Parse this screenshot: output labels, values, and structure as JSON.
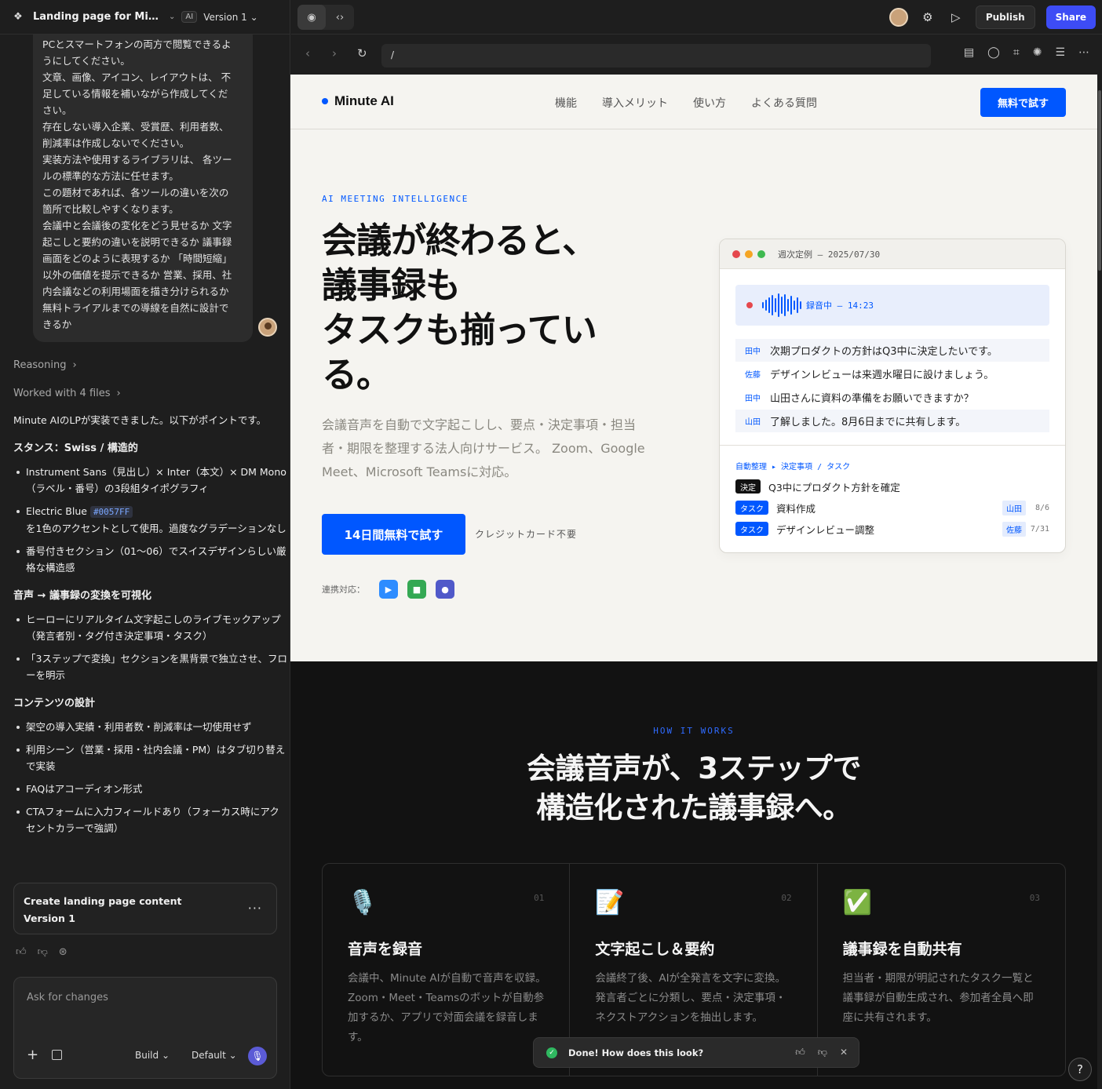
{
  "header": {
    "project_title": "Landing page for Minut...",
    "ai_badge": "AI",
    "version": "Version 1"
  },
  "chat": {
    "user_message": [
      "PCとスマートフォンの両方で閲覧できるよ",
      "うにしてください。",
      "文章、画像、アイコン、レイアウトは、 不",
      "足している情報を補いながら作成してくだ",
      "さい。",
      "存在しない導入企業、受賞歴、利用者数、",
      "削減率は作成しないでください。",
      "実装方法や使用するライブラリは、 各ツー",
      "ルの標準的な方法に任せます。",
      "この題材であれば、各ツールの違いを次の",
      "箇所で比較しやすくなります。",
      "会議中と会議後の変化をどう見せるか 文字",
      "起こしと要約の違いを説明できるか 議事録",
      "画面をどのように表現するか 「時間短縮」",
      "以外の価値を提示できるか 営業、採用、社",
      "内会議などの利用場面を描き分けられるか",
      "無料トライアルまでの導線を自然に設計で",
      "きるか"
    ],
    "reasoning_label": "Reasoning",
    "worked_label": "Worked with 4 files",
    "reply_intro": "Minute AIのLPが実装できました。以下がポイントです。",
    "sections": [
      {
        "heading": "スタンス：Swiss / 構造的",
        "items": [
          {
            "text": "Instrument Sans（見出し）× Inter（本文）× DM Mono（ラベル・番号）の3段組タイポグラフィ"
          },
          {
            "prefix": "Electric Blue ",
            "code": "#0057FF",
            "text": "を1色のアクセントとして使用。過度なグラデーションなし"
          },
          {
            "text": "番号付きセクション（01〜06）でスイスデザインらしい厳格な構造感"
          }
        ]
      },
      {
        "heading": "音声 → 議事録の変換を可視化",
        "items": [
          {
            "text": "ヒーローにリアルタイム文字起こしのライブモックアップ（発言者別・タグ付き決定事項・タスク）"
          },
          {
            "text": "「3ステップで変換」セクションを黒背景で独立させ、フローを明示"
          }
        ]
      },
      {
        "heading": "コンテンツの設計",
        "items": [
          {
            "text": "架空の導入実績・利用者数・削減率は一切使用せず"
          },
          {
            "text": "利用シーン（営業・採用・社内会議・PM）はタブ切り替えで実装"
          },
          {
            "text": "FAQはアコーディオン形式"
          },
          {
            "text": "CTAフォームに入力フィールドあり（フォーカス時にアクセントカラーで強調）"
          }
        ]
      }
    ],
    "version_card": {
      "title": "Create landing page content",
      "version": "Version 1",
      "more": "···"
    },
    "composer": {
      "placeholder": "Ask for changes",
      "plus": "+",
      "mode": "Build",
      "model": "Default"
    }
  },
  "topbar": {
    "publish": "Publish",
    "share": "Share"
  },
  "urlbar": {
    "url": "/"
  },
  "site": {
    "brand": "Minute AI",
    "menu": [
      "機能",
      "導入メリット",
      "使い方",
      "よくある質問"
    ],
    "nav_cta": "無料で試す",
    "eyebrow": "AI MEETING INTELLIGENCE",
    "hero_lines": [
      "会議が終わると、",
      "議事録も",
      "タスクも揃ってい",
      "る。"
    ],
    "hero_sub": "会議音声を自動で文字起こしし、要点・決定事項・担当者・期限を整理する法人向けサービス。 Zoom、Google Meet、Microsoft Teamsに対応。",
    "hero_cta": "14日間無料で試す",
    "hero_note": "クレジットカード不要",
    "integrations_label": "連携対応：",
    "mock": {
      "title": "週次定例 — 2025/07/30",
      "recording": "録音中 — 14:23",
      "transcript": [
        {
          "speaker": "田中",
          "text": "次期プロダクトの方針はQ3中に決定したいです。",
          "highlight": true
        },
        {
          "speaker": "佐藤",
          "text": "デザインレビューは来週水曜日に設けましょう。",
          "highlight": false
        },
        {
          "speaker": "田中",
          "text": "山田さんに資料の準備をお願いできますか？",
          "highlight": false
        },
        {
          "speaker": "山田",
          "text": "了解しました。8月6日までに共有します。",
          "highlight": true
        }
      ],
      "breadcrumb": "自動整理 ▸ 決定事項 / タスク",
      "items": [
        {
          "tag": "決定",
          "kind": "dec",
          "text": "Q3中にプロダクト方針を確定",
          "assignee": "",
          "due": ""
        },
        {
          "tag": "タスク",
          "kind": "task",
          "text": "資料作成",
          "assignee": "山田",
          "due": "8/6"
        },
        {
          "tag": "タスク",
          "kind": "task",
          "text": "デザインレビュー調整",
          "assignee": "佐藤",
          "due": "7/31"
        }
      ]
    },
    "how": {
      "eyebrow": "HOW IT WORKS",
      "heading_lines": [
        "会議音声が、3ステップで",
        "構造化された議事録へ。"
      ],
      "steps": [
        {
          "emoji": "🎙️",
          "num": "01",
          "title": "音声を録音",
          "desc": "会議中、Minute AIが自動で音声を収録。Zoom・Meet・Teamsのボットが自動参加するか、アプリで対面会議を録音します。"
        },
        {
          "emoji": "📝",
          "num": "02",
          "title": "文字起こし＆要約",
          "desc": "会議終了後、AIが全発言を文字に変換。発言者ごとに分類し、要点・決定事項・ネクストアクションを抽出します。"
        },
        {
          "emoji": "✅",
          "num": "03",
          "title": "議事録を自動共有",
          "desc": "担当者・期限が明記されたタスク一覧と議事録が自動生成され、参加者全員へ即座に共有されます。"
        }
      ]
    }
  },
  "toast": {
    "text": "Done! How does this look?"
  },
  "help": "?"
}
